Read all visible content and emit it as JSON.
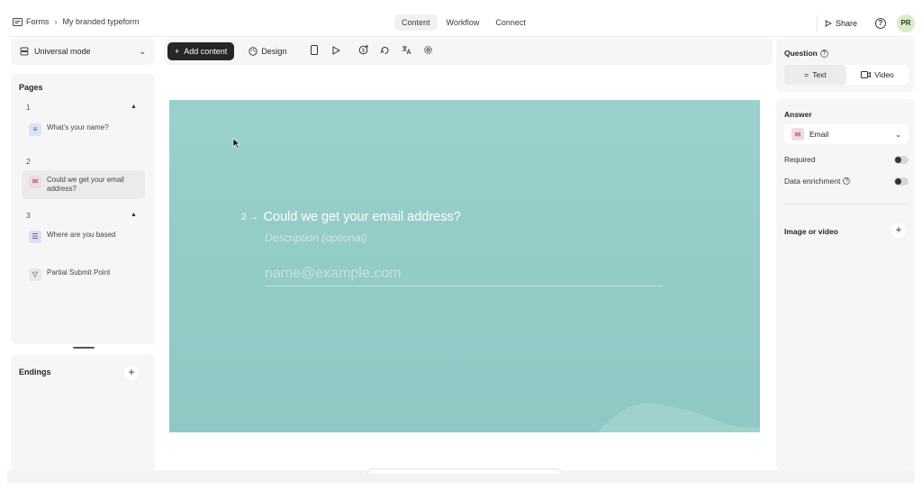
{
  "breadcrumb": {
    "root": "Forms",
    "current": "My branded typeform"
  },
  "top_tabs": [
    {
      "label": "Content",
      "active": true
    },
    {
      "label": "Workflow",
      "active": false
    },
    {
      "label": "Connect",
      "active": false
    }
  ],
  "top_right": {
    "share_label": "Share",
    "help_label": "?",
    "avatar_initials": "PR"
  },
  "left_panel": {
    "mode_label": "Universal mode",
    "pages_title": "Pages",
    "pages": [
      {
        "number": "1",
        "label": "What's your name?",
        "icon": "short-text-icon"
      },
      {
        "number": "2",
        "label": "Could we get your email address?",
        "icon": "email-icon"
      },
      {
        "number": "3",
        "label": "Where are you based",
        "icon": "multiple-choice-icon"
      }
    ],
    "partial_submit_label": "Partial Submit Point",
    "endings_title": "Endings"
  },
  "toolbar": {
    "add_content_label": "Add content",
    "design_label": "Design"
  },
  "canvas": {
    "question_number": "2",
    "question_text": "Could we get your email address?",
    "description_placeholder": "Description (optional)",
    "email_placeholder": "name@example.com"
  },
  "right_panel": {
    "question_title": "Question",
    "text_tab": "Text",
    "video_tab": "Video",
    "answer_title": "Answer",
    "answer_type": "Email",
    "required_label": "Required",
    "data_enrichment_label": "Data enrichment",
    "image_or_video_label": "Image or video"
  },
  "colors": {
    "canvas_background": "#95ccc8",
    "accent_dark": "#262627",
    "panel_background": "#f6f6f6"
  }
}
